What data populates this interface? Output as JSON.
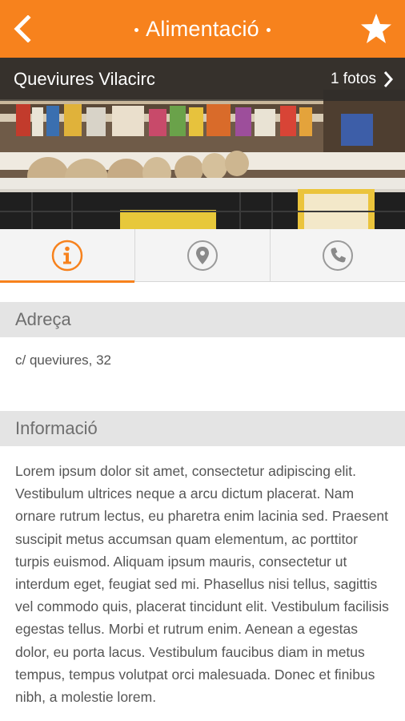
{
  "header": {
    "title": "Alimentació",
    "back_icon": "chevron-left-icon",
    "favorite_icon": "star-icon",
    "accent_color": "#f7821d"
  },
  "hero": {
    "store_name": "Queviures Vilacirc",
    "photos_label": "1 fotos",
    "photos_icon": "chevron-right-icon"
  },
  "tabs": [
    {
      "name": "info",
      "icon": "info-icon",
      "active": true
    },
    {
      "name": "map",
      "icon": "map-pin-icon",
      "active": false
    },
    {
      "name": "phone",
      "icon": "phone-icon",
      "active": false
    }
  ],
  "sections": {
    "address_title": "Adreça",
    "address_value": "c/ queviures, 32",
    "info_title": "Informació",
    "info_text": "Lorem ipsum dolor sit amet, consectetur adipiscing elit. Vestibulum ultrices neque a arcu dictum placerat. Nam ornare rutrum lectus, eu pharetra enim lacinia sed. Praesent suscipit metus accumsan quam elementum, ac porttitor turpis euismod. Aliquam ipsum mauris, consectetur ut interdum eget, feugiat sed mi. Phasellus nisi tellus, sagittis vel commodo quis, placerat tincidunt elit. Vestibulum facilisis egestas tellus. Morbi et rutrum enim. Aenean a egestas dolor, eu porta lacus. Vestibulum faucibus diam in metus tempus, tempus volutpat orci malesuada. Donec et finibus nibh, a molestie lorem."
  }
}
